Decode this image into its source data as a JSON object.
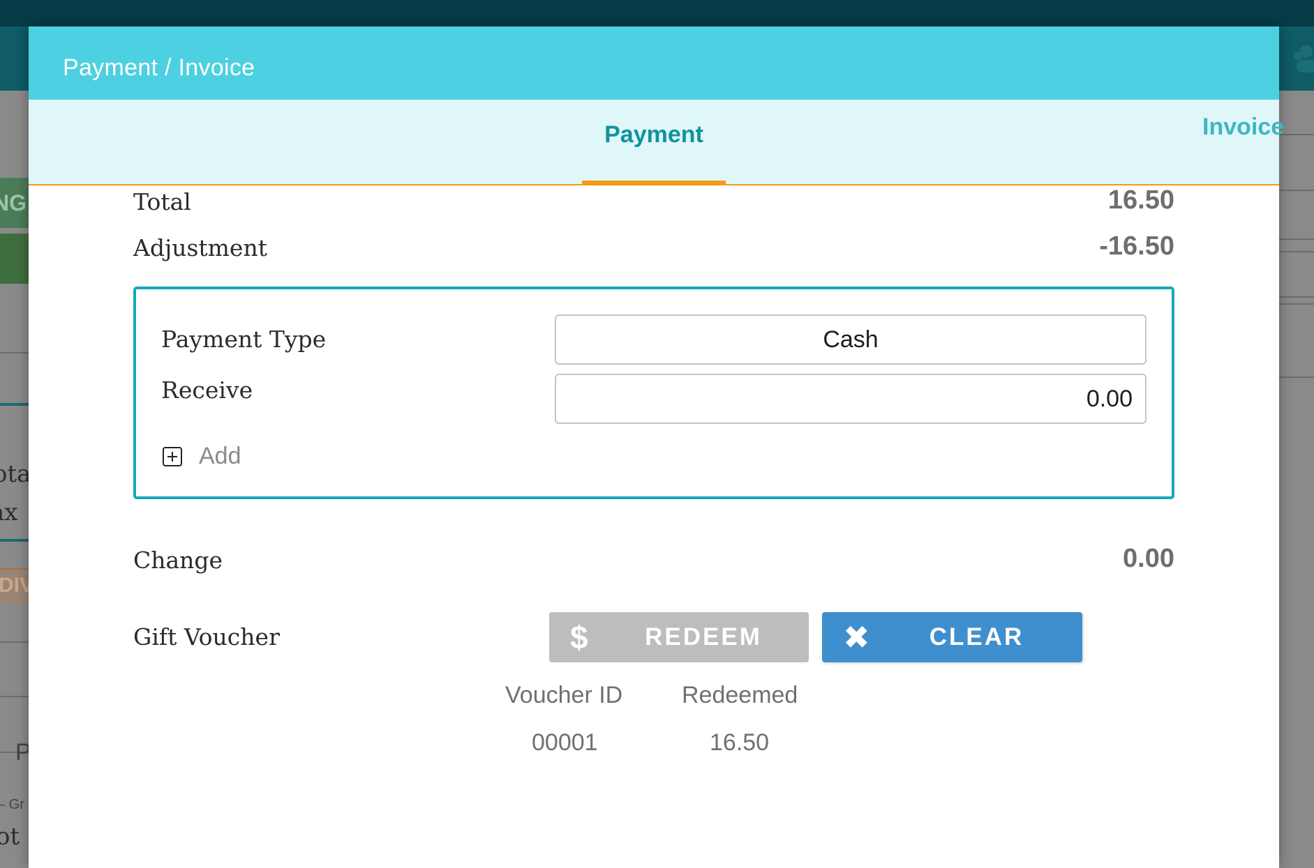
{
  "dialog": {
    "title": "Payment / Invoice",
    "tabs": [
      {
        "label": "Payment",
        "active": true
      },
      {
        "label": "Invoice",
        "active": false
      }
    ]
  },
  "summary": {
    "total_label": "Total",
    "total_value": "16.50",
    "adjustment_label": "Adjustment",
    "adjustment_value": "-16.50"
  },
  "payment_box": {
    "type_label": "Payment Type",
    "type_value": "Cash",
    "receive_label": "Receive",
    "receive_value": "0.00",
    "add_label": "Add"
  },
  "change": {
    "label": "Change",
    "value": "0.00"
  },
  "gift_voucher": {
    "label": "Gift Voucher",
    "redeem_label": "REDEEM",
    "redeem_icon": "dollar-icon",
    "clear_label": "CLEAR",
    "clear_icon": "close-icon",
    "columns": [
      "Voucher ID",
      "Redeemed"
    ],
    "rows": [
      [
        "00001",
        "16.50"
      ]
    ]
  },
  "background": {
    "left_fragments": [
      "t",
      "NG",
      "ota",
      "ax",
      "DIV",
      "P",
      "– Gr",
      "ot S"
    ]
  },
  "colors": {
    "header": "#4dd0e1",
    "tab_bar": "#e0f7fa",
    "tab_accent": "#f39c12",
    "tab_text": "#10939d",
    "box_border": "#17a8b8",
    "redeem_button": "#bdbdbd",
    "clear_button": "#3f8fce"
  }
}
